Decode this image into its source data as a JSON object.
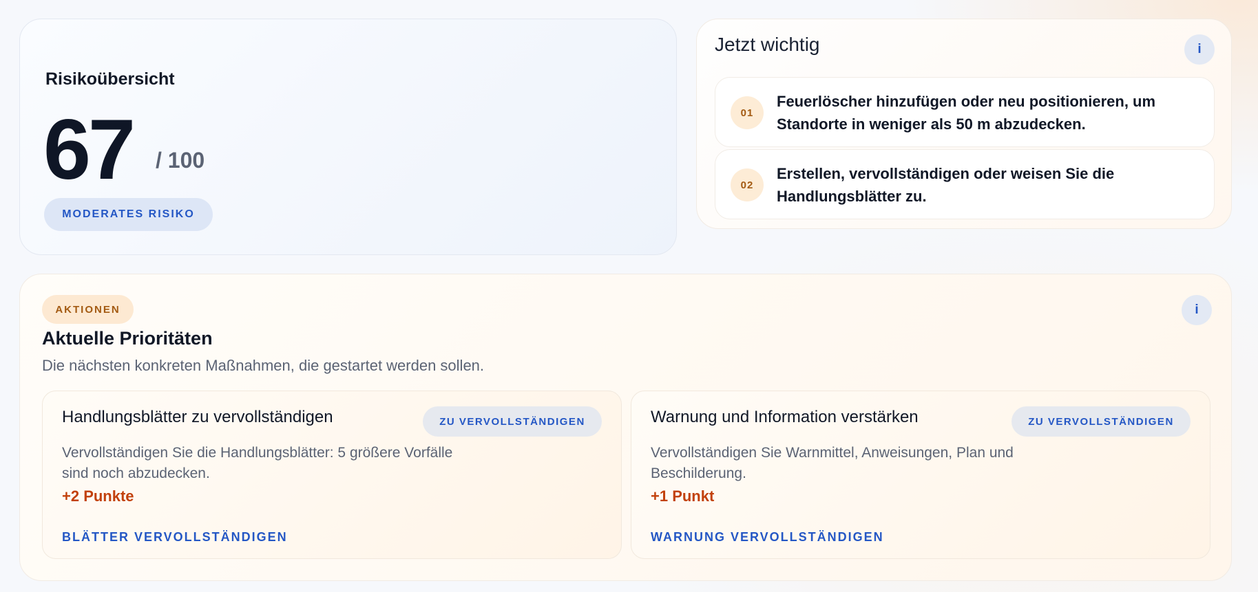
{
  "risk": {
    "title": "Risikoübersicht",
    "score": "67",
    "score_max": "/ 100",
    "level_badge": "MODERATES RISIKO"
  },
  "now": {
    "title": "Jetzt wichtig",
    "info_icon": "i",
    "items": [
      {
        "num": "01",
        "text": "Feuerlöscher hinzufügen oder neu positionieren, um Standorte in weniger als 50 m abzudecken."
      },
      {
        "num": "02",
        "text": "Erstellen, vervollständigen oder weisen Sie die Handlungsblätter zu."
      }
    ]
  },
  "actions": {
    "tag": "AKTIONEN",
    "info_icon": "i",
    "heading": "Aktuelle Prioritäten",
    "subtitle": "Die nächsten konkreten Maßnahmen, die gestartet werden sollen.",
    "cards": [
      {
        "title": "Handlungsblätter zu vervollständigen",
        "status": "ZU VERVOLLSTÄNDIGEN",
        "description": "Vervollständigen Sie die Handlungsblätter: 5 größere Vorfälle sind noch abzudecken.",
        "points": "+2 Punkte",
        "link": "BLÄTTER VERVOLLSTÄNDIGEN"
      },
      {
        "title": "Warnung und Information verstärken",
        "status": "ZU VERVOLLSTÄNDIGEN",
        "description": "Vervollständigen Sie Warnmittel, Anweisungen, Plan und Beschilderung.",
        "points": "+1 Punkt",
        "link": "WARNUNG VERVOLLSTÄNDIGEN"
      }
    ]
  },
  "colors": {
    "accent_blue": "#2457c5",
    "accent_orange": "#c2410c",
    "tag_orange": "#a35a12"
  }
}
